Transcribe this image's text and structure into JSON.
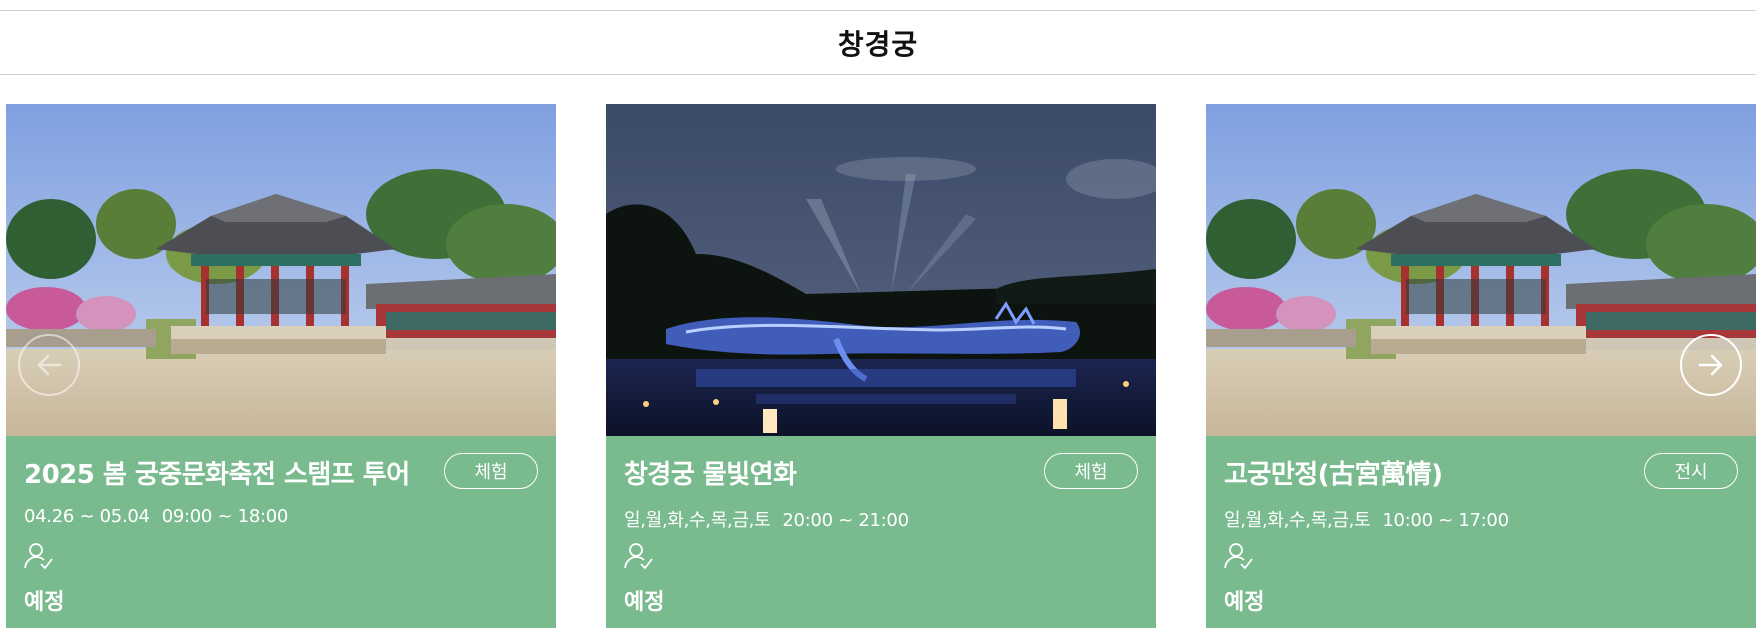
{
  "section": {
    "title": "창경궁"
  },
  "cards": [
    {
      "title": "2025 봄 궁중문화축전 스탬프 투어",
      "type": "체험",
      "dates": "04.26 ~ 05.04",
      "time": "09:00 ~ 18:00",
      "status": "예정",
      "image": "palace-pavilion-photo"
    },
    {
      "title": "창경궁 물빛연화",
      "type": "체험",
      "dates": "일,월,화,수,목,금,토",
      "time": "20:00 ~ 21:00",
      "status": "예정",
      "image": "night-light-show-photo"
    },
    {
      "title": "고궁만정(古宮萬情)",
      "type": "전시",
      "dates": "일,월,화,수,목,금,토",
      "time": "10:00 ~ 17:00",
      "status": "예정",
      "image": "palace-pavilion-photo"
    }
  ],
  "navigation": {
    "prev_icon": "arrow-left-icon",
    "next_icon": "arrow-right-icon"
  },
  "colors": {
    "card_info_bg": "#7aba8f",
    "text": "#ffffff",
    "header_text": "#111111"
  }
}
